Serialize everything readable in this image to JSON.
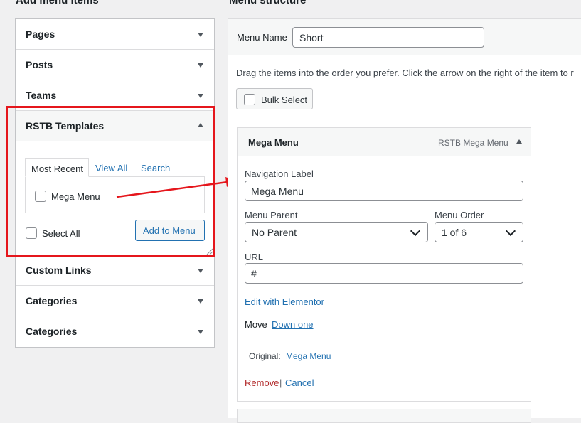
{
  "left": {
    "heading": "Add menu items",
    "accordion_top": [
      "Pages",
      "Posts",
      "Teams"
    ],
    "rstb": {
      "title": "RSTB Templates",
      "tabs": [
        "Most Recent",
        "View All",
        "Search"
      ],
      "item_label": "Mega Menu",
      "select_all": "Select All",
      "add_button": "Add to Menu"
    },
    "accordion_bottom": [
      "Custom Links",
      "Categories",
      "Categories"
    ]
  },
  "right": {
    "heading": "Menu structure",
    "menu_name_label": "Menu Name",
    "menu_name_value": "Short",
    "instructions": "Drag the items into the order you prefer. Click the arrow on the right of the item to r",
    "bulk_select": "Bulk Select",
    "item": {
      "title": "Mega Menu",
      "type": "RSTB Mega Menu",
      "nav_label_label": "Navigation Label",
      "nav_label_value": "Mega Menu",
      "menu_parent_label": "Menu Parent",
      "menu_parent_value": "No Parent",
      "menu_order_label": "Menu Order",
      "menu_order_value": "1 of 6",
      "url_label": "URL",
      "url_value": "#",
      "edit_link": "Edit with Elementor",
      "move_label": "Move",
      "move_link": "Down one",
      "original_label": "Original:",
      "original_link": "Mega Menu",
      "remove": "Remove",
      "separator": "|",
      "cancel": "Cancel"
    }
  },
  "colors": {
    "highlight_red": "#e5161c",
    "link": "#2271b1"
  }
}
